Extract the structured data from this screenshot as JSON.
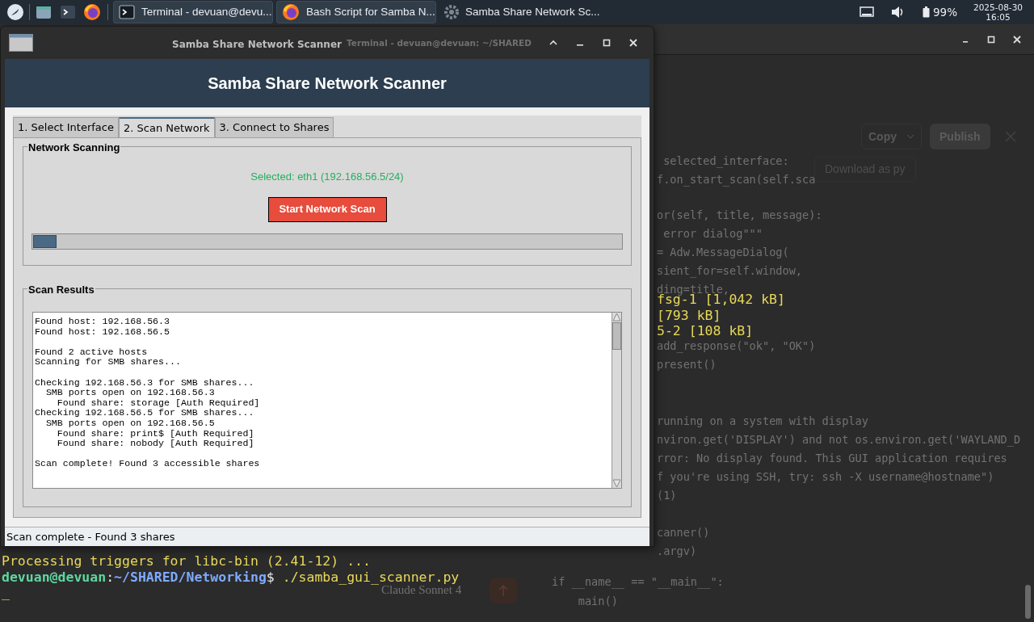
{
  "taskbar": {
    "launchers": [
      {
        "kind": "menu"
      },
      {
        "kind": "files"
      },
      {
        "kind": "terminal"
      },
      {
        "kind": "browser"
      }
    ],
    "tasks": [
      {
        "kind": "terminal",
        "label": "Terminal - devuan@devu...",
        "selected": false
      },
      {
        "kind": "browser",
        "label": "Bash Script for Samba N...",
        "selected": false
      },
      {
        "kind": "app",
        "label": "Samba Share Network Sc...",
        "selected": true
      }
    ],
    "battery": "99%",
    "date": "2025-08-30",
    "time": "16:05"
  },
  "terminal": {
    "side_lines": [
      "fsg-1 [1,042 kB]",
      "[793 kB]",
      "5-2 [108 kB]"
    ],
    "title_visible": "Terminal - devuan@devuan: ~/SHARED",
    "lines": [
      "Processing triggers for libc-bin (2.41-12) ..."
    ],
    "prompt": {
      "user": "devuan@devuan",
      "separator": ":",
      "path": "~/SHARED/Networking",
      "symbol": "$",
      "command": " ./samba_gui_scanner.py"
    },
    "cursor": "_"
  },
  "browser_behind": {
    "copy": "Copy",
    "publish": "Publish",
    "download": "Download as py",
    "model": "Claude Sonnet 4",
    "code_blocks": [
      [
        " selected_interface:",
        "f.on_start_scan(self.sca"
      ],
      [
        "or(self, title, message):",
        " error dialog\"\"\"",
        "= Adw.MessageDialog(",
        "sient_for=self.window,",
        "ding=title,"
      ],
      [
        "add_response(\"ok\", \"OK\")",
        "present()"
      ],
      [
        "running on a system with display",
        "nviron.get('DISPLAY') and not os.environ.get('WAYLAND_D",
        "rror: No display found. This GUI application requires",
        "f you're using SSH, try: ssh -X username@hostname\")",
        "(1)"
      ],
      [
        "canner()",
        ".argv)"
      ]
    ],
    "main_lines": [
      "if __name__ == \"__main__\":",
      "    main()"
    ]
  },
  "scanner": {
    "window_title": "Samba Share Network Scanner",
    "header": "Samba Share Network Scanner",
    "tabs": [
      {
        "label": "1. Select Interface",
        "selected": false
      },
      {
        "label": "2. Scan Network",
        "selected": true
      },
      {
        "label": "3. Connect to Shares",
        "selected": false
      }
    ],
    "scanning": {
      "title": "Network Scanning",
      "selected_interface": "Selected: eth1 (192.168.56.5/24)",
      "button": "Start Network Scan",
      "progress": {
        "level": 0.04
      }
    },
    "results": {
      "title": "Scan Results",
      "paragraphs": [
        [
          "Found host: 192.168.56.3",
          "Found host: 192.168.56.5"
        ],
        [
          "Found 2 active hosts",
          "Scanning for SMB shares..."
        ],
        [
          "Checking 192.168.56.3 for SMB shares...",
          "  SMB ports open on 192.168.56.3",
          "    Found share: storage [Auth Required]",
          "Checking 192.168.56.5 for SMB shares...",
          "  SMB ports open on 192.168.56.5",
          "    Found share: print$ [Auth Required]",
          "    Found share: nobody [Auth Required]"
        ],
        [
          "Scan complete! Found 3 accessible shares"
        ]
      ]
    },
    "status": "Scan complete - Found 3 shares"
  }
}
